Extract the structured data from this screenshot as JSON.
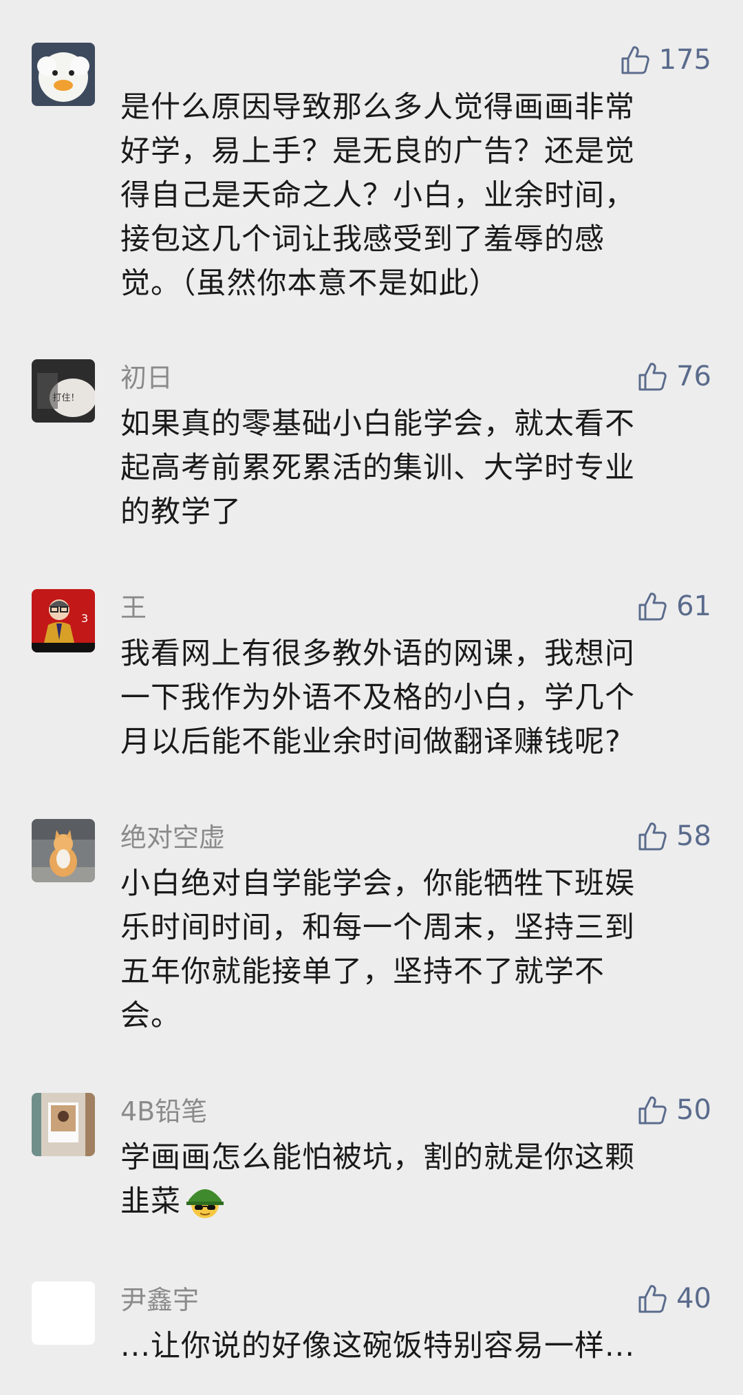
{
  "comments": [
    {
      "username": "",
      "likes": "175",
      "text": "是什么原因导致那么多人觉得画画非常\n好学，易上手？是无良的广告？还是觉\n得自己是天命之人？小白，业余时间，\n接包这几个词让我感受到了羞辱的感\n觉。（虽然你本意不是如此）"
    },
    {
      "username": "初日",
      "likes": "76",
      "text": "如果真的零基础小白能学会，就太看不\n起高考前累死累活的集训、大学时专业\n的教学了",
      "avatar_caption": "打住！"
    },
    {
      "username": "王",
      "likes": "61",
      "text": "我看网上有很多教外语的网课，我想问\n一下我作为外语不及格的小白，学几个\n月以后能不能业余时间做翻译赚钱呢?",
      "avatar_caption": "3"
    },
    {
      "username": "绝对空虚",
      "likes": "58",
      "text": "小白绝对自学能学会，你能牺牲下班娱\n乐时间时间，和每一个周末，坚持三到\n五年你就能接单了，坚持不了就学不\n会。"
    },
    {
      "username": "4B铅笔",
      "likes": "50",
      "text": "学画画怎么能怕被坑，割的就是你这颗\n韭菜",
      "emoji": "green-helmet-sunglasses-emoji"
    },
    {
      "username": "尹鑫宇",
      "likes": "40",
      "text": "...让你说的好像这碗饭特别容易一样..."
    }
  ],
  "icons": {
    "like": "thumbs-up-outline-icon"
  },
  "colors": {
    "background": "#ededed",
    "username": "#8a8a8a",
    "like": "#5a6b8c",
    "text": "#1a1a1a"
  }
}
